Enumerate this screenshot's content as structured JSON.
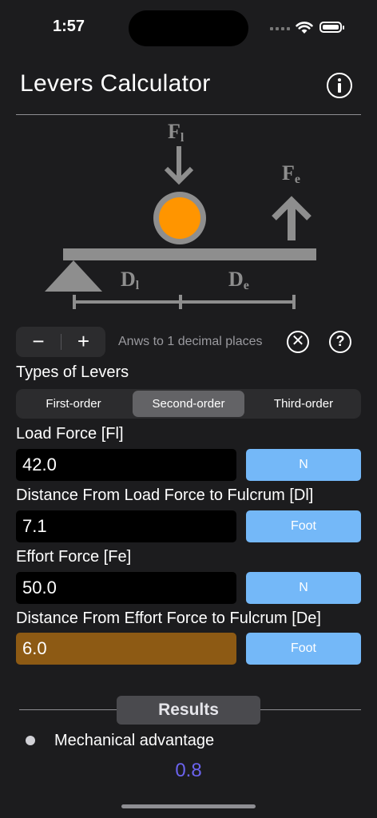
{
  "status": {
    "time": "1:57"
  },
  "header": {
    "title": "Levers Calculator"
  },
  "diagram": {
    "load_label": "F",
    "load_sub": "l",
    "effort_label": "F",
    "effort_sub": "e",
    "dist_load_label": "D",
    "dist_load_sub": "l",
    "dist_effort_label": "D",
    "dist_effort_sub": "e",
    "colors": {
      "lever": "#8e8e8e",
      "ball": "#ff9500"
    }
  },
  "precision": {
    "minus": "−",
    "plus": "+",
    "text": "Anws to 1 decimal places"
  },
  "types": {
    "label": "Types of Levers",
    "options": [
      "First-order",
      "Second-order",
      "Third-order"
    ],
    "selected": "Second-order"
  },
  "fields": [
    {
      "label": "Load Force [Fl]",
      "value": "42.0",
      "unit": "N"
    },
    {
      "label": "Distance From Load Force to Fulcrum [Dl]",
      "value": "7.1",
      "unit": "Foot"
    },
    {
      "label": "Effort Force [Fe]",
      "value": "50.0",
      "unit": "N"
    },
    {
      "label": "Distance From Effort Force to Fulcrum [De]",
      "value": "6.0",
      "unit": "Foot"
    }
  ],
  "results": {
    "heading": "Results",
    "items": [
      {
        "label": "Mechanical advantage",
        "value": "0.8"
      }
    ]
  },
  "colors": {
    "accent": "#74b8f8",
    "active_field": "#8d5a14",
    "result_value": "#6b63ee"
  }
}
